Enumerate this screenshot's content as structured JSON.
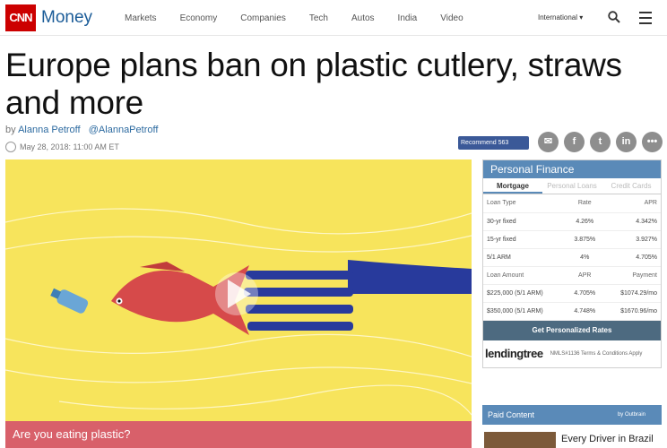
{
  "nav": {
    "logo": "CNN",
    "brand": "Money",
    "links": [
      "Markets",
      "Economy",
      "Companies",
      "Tech",
      "Autos",
      "India",
      "Video"
    ],
    "edition": "International ▾"
  },
  "article": {
    "title": "Europe plans ban on plastic cutlery, straws and more",
    "by": "by",
    "author": "Alanna Petroff",
    "handle": "@AlannaPetroff",
    "date": "May 28, 2018: 11:00 AM ET",
    "recommend": "Recommend 563"
  },
  "social": [
    "✉",
    "f",
    "t",
    "in",
    "•••"
  ],
  "video": {
    "caption": "Are you eating plastic?"
  },
  "finance": {
    "title": "Personal Finance",
    "tabs": [
      "Mortgage",
      "Personal Loans",
      "Credit Cards"
    ],
    "rows": [
      [
        "Loan Type",
        "Rate",
        "APR"
      ],
      [
        "30-yr fixed",
        "4.26%",
        "4.342%"
      ],
      [
        "15-yr fixed",
        "3.875%",
        "3.927%"
      ],
      [
        "5/1 ARM",
        "4%",
        "4.705%"
      ],
      [
        "Loan Amount",
        "APR",
        "Payment"
      ],
      [
        "$225,000 (5/1 ARM)",
        "4.705%",
        "$1074.29/mo"
      ],
      [
        "$350,000 (5/1 ARM)",
        "4.748%",
        "$1670.96/mo"
      ]
    ],
    "cta": "Get Personalized Rates",
    "lender": "lendingtree",
    "lender_note": "NMLS#1136 Terms & Conditions Apply"
  },
  "paid": {
    "title": "Paid Content",
    "by": "by Outbrain",
    "teaser": "Every Driver in Brazil"
  }
}
